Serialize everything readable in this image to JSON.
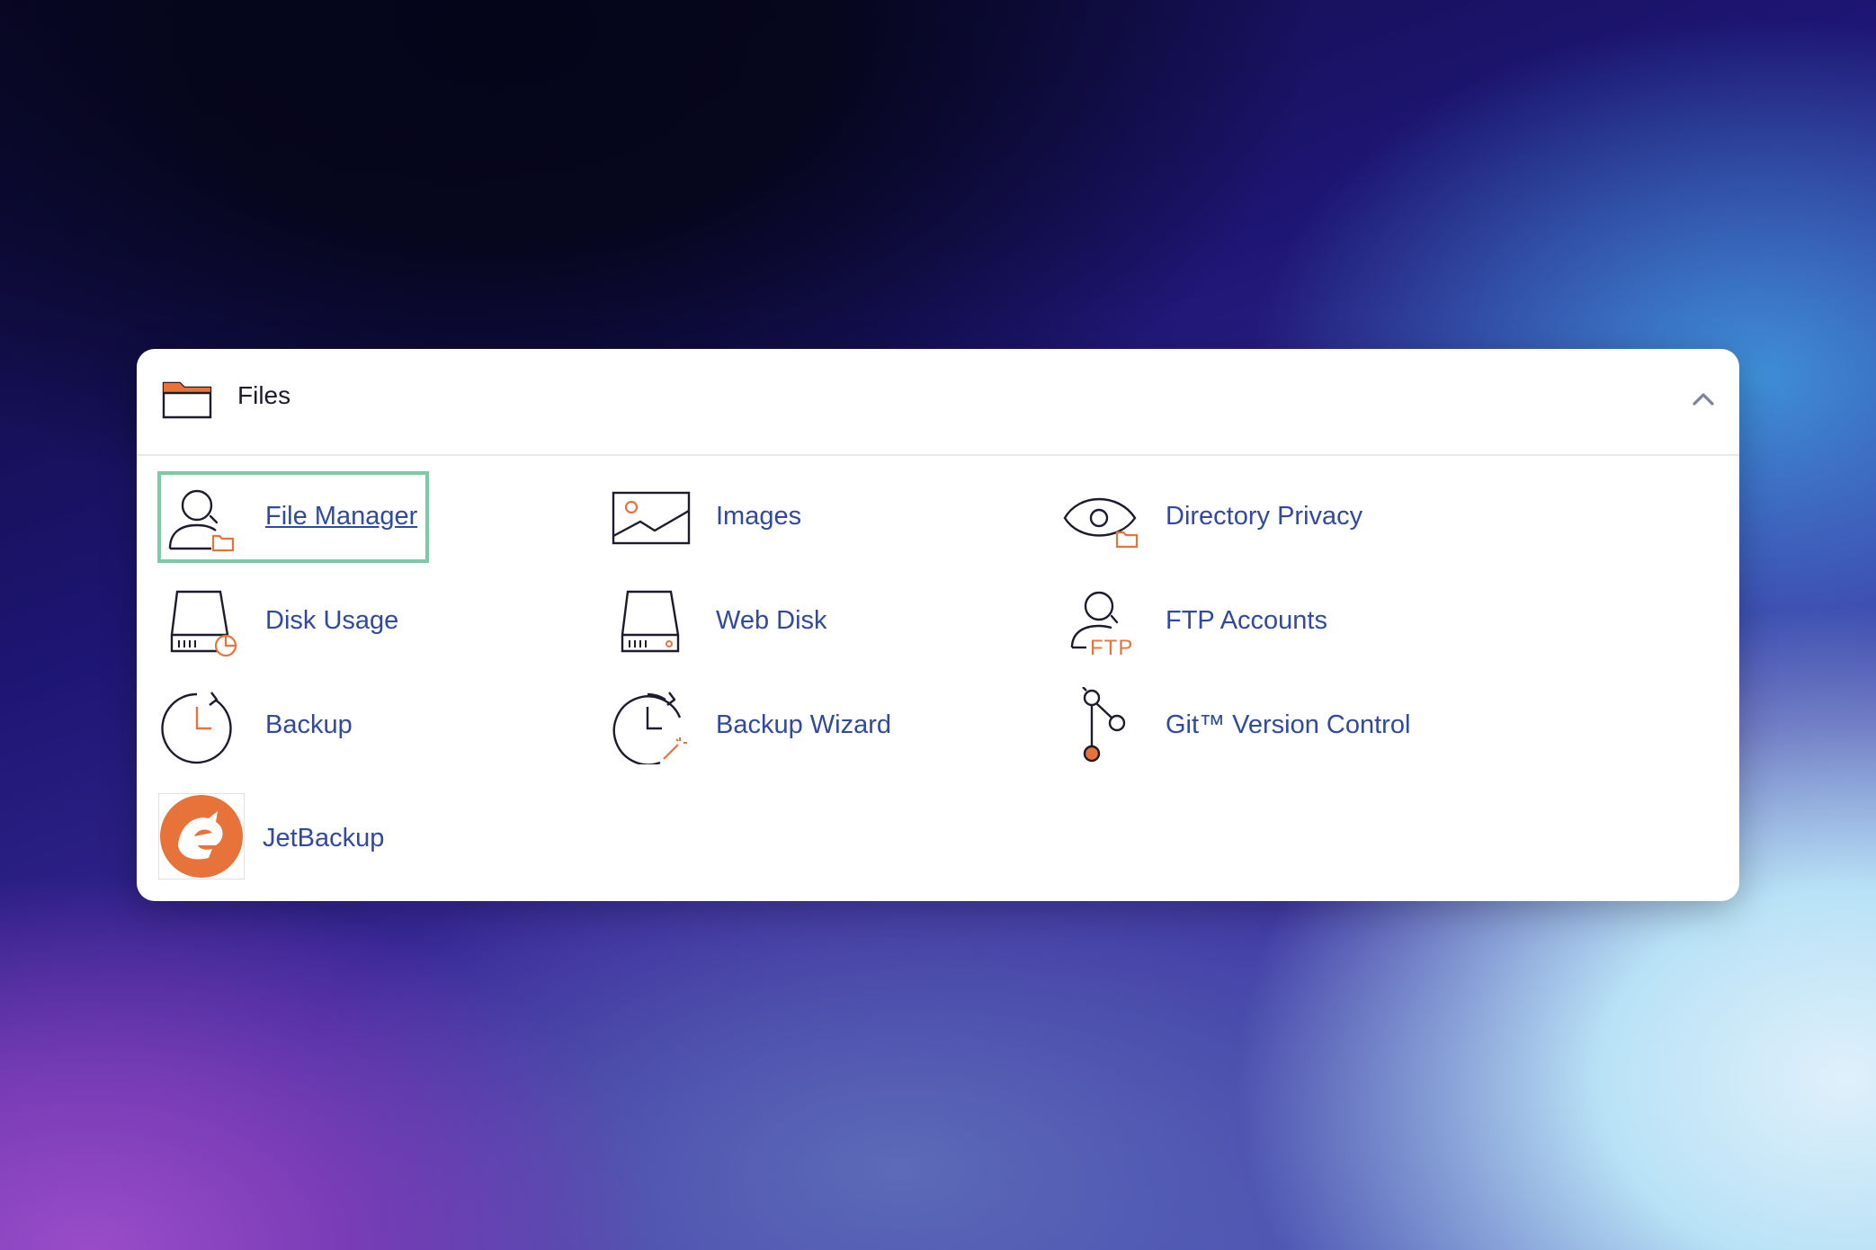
{
  "section": {
    "title": "Files",
    "icon": "folder-icon",
    "toggle_icon": "chevron-up-icon"
  },
  "colors": {
    "accent": "#e8733a",
    "link": "#2f4aa0",
    "focus_outline": "#7dcaa6"
  },
  "tools": [
    {
      "label": "File Manager",
      "icon": "file-manager-icon",
      "focused": true
    },
    {
      "label": "Images",
      "icon": "images-icon",
      "focused": false
    },
    {
      "label": "Directory Privacy",
      "icon": "directory-privacy-icon",
      "focused": false
    },
    {
      "label": "Disk Usage",
      "icon": "disk-usage-icon",
      "focused": false
    },
    {
      "label": "Web Disk",
      "icon": "web-disk-icon",
      "focused": false
    },
    {
      "label": "FTP Accounts",
      "icon": "ftp-accounts-icon",
      "ftp_icon_text": "FTP",
      "focused": false
    },
    {
      "label": "Backup",
      "icon": "backup-icon",
      "focused": false
    },
    {
      "label": "Backup Wizard",
      "icon": "backup-wizard-icon",
      "focused": false
    },
    {
      "label": "Git™ Version Control",
      "icon": "git-icon",
      "focused": false
    },
    {
      "label": "JetBackup",
      "icon": "jetbackup-icon",
      "focused": false
    }
  ]
}
